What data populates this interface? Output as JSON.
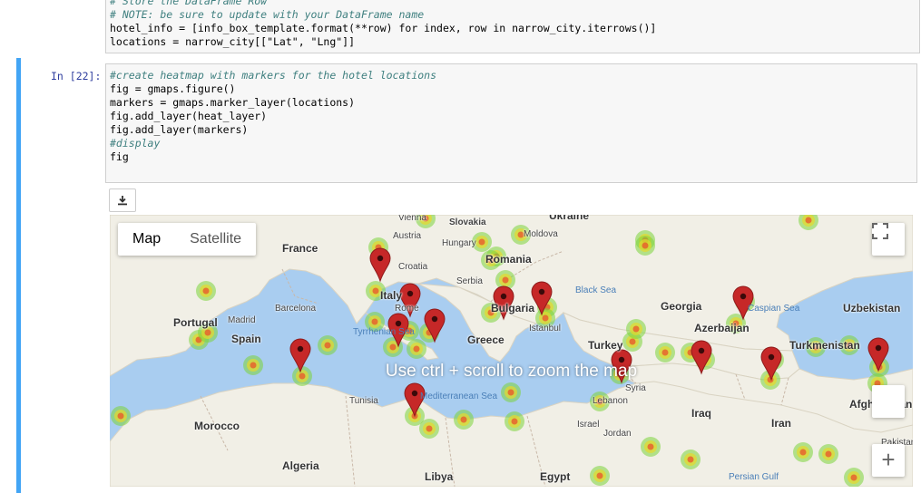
{
  "prev_cell": {
    "lines": [
      "# Store the DataFrame Row",
      "# NOTE: be sure to update with your DataFrame name",
      "hotel_info = [info_box_template.format(**row) for index, row in narrow_city.iterrows()]",
      "locations = narrow_city[[\"Lat\", \"Lng\"]]"
    ]
  },
  "cell": {
    "prompt": "In [22]:",
    "lines": [
      "#create heatmap with markers for the hotel locations",
      "fig = gmaps.figure()",
      "markers = gmaps.marker_layer(locations)",
      "fig.add_layer(heat_layer)",
      "fig.add_layer(markers)",
      "#display",
      "fig"
    ]
  },
  "output": {
    "download_icon": "download-icon",
    "map": {
      "type_buttons": [
        "Map",
        "Satellite"
      ],
      "active_type": "Map",
      "zoom_hint": "Use ctrl + scroll to zoom the map",
      "zoom_in_label": "+",
      "places": [
        {
          "name": "Ukraine"
        },
        {
          "name": "Slovakia"
        },
        {
          "name": "Vienna"
        },
        {
          "name": "Austria"
        },
        {
          "name": "Hungary"
        },
        {
          "name": "Moldova"
        },
        {
          "name": "France"
        },
        {
          "name": "Romania"
        },
        {
          "name": "Croatia"
        },
        {
          "name": "Serbia"
        },
        {
          "name": "Black Sea"
        },
        {
          "name": "Italy"
        },
        {
          "name": "Rome"
        },
        {
          "name": "Bulgaria"
        },
        {
          "name": "Georgia"
        },
        {
          "name": "Uzbekistan"
        },
        {
          "name": "Barcelona"
        },
        {
          "name": "Portugal"
        },
        {
          "name": "Madrid"
        },
        {
          "name": "Spain"
        },
        {
          "name": "Tyrrhenian Sea"
        },
        {
          "name": "Istanbul"
        },
        {
          "name": "Azerbaijan"
        },
        {
          "name": "Caspian Sea"
        },
        {
          "name": "Greece"
        },
        {
          "name": "Turkey"
        },
        {
          "name": "Turkmenistan"
        },
        {
          "name": "Tunisia"
        },
        {
          "name": "Mediterranean Sea"
        },
        {
          "name": "Syria"
        },
        {
          "name": "Lebanon"
        },
        {
          "name": "Iraq"
        },
        {
          "name": "Afghanistan"
        },
        {
          "name": "Morocco"
        },
        {
          "name": "Israel"
        },
        {
          "name": "Jordan"
        },
        {
          "name": "Iran"
        },
        {
          "name": "Algeria"
        },
        {
          "name": "Libya"
        },
        {
          "name": "Egypt"
        },
        {
          "name": "Persian Gulf"
        },
        {
          "name": "Pakistan"
        }
      ]
    }
  },
  "colors": {
    "cell_bar": "#42a5f5",
    "prompt": "#303f9f",
    "marker": "#c62828",
    "water": "#a9cdf0",
    "land": "#f1efe6"
  }
}
